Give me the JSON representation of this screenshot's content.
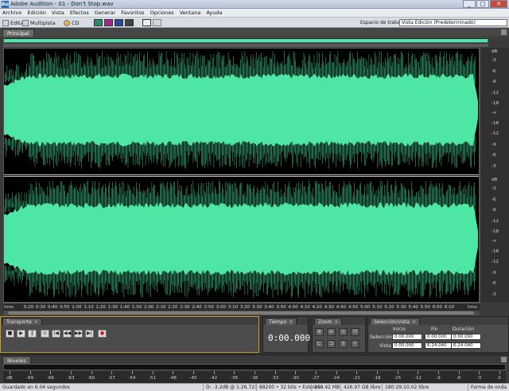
{
  "window": {
    "title": "Adobe Audition - 01 - Don't Stop.wav",
    "buttons": [
      "_",
      "□",
      "✕"
    ]
  },
  "menu": [
    "Archivo",
    "Edición",
    "Vista",
    "Efectos",
    "Generar",
    "Favoritos",
    "Opciones",
    "Ventana",
    "Ayuda"
  ],
  "toolbar": {
    "edit": "Editar",
    "multitrack": "Multipista",
    "cd": "CD",
    "workspace_label": "Espacio de trabajo:",
    "workspace_value": "Vista Edición (Predeterminado)"
  },
  "main_panel": {
    "tab": "Principal",
    "db_labels": [
      "dB",
      "-3",
      "-6",
      "-9",
      "-12",
      "-18",
      "-∞",
      "-18",
      "-12",
      "-9",
      "-6",
      "-3",
      "dB",
      "-3",
      "-6",
      "-9",
      "-12",
      "-18",
      "-∞",
      "-18",
      "-12",
      "-9",
      "-6",
      "-3"
    ],
    "ruler_start": "hms",
    "ruler_end": "hms",
    "ruler_labels": [
      "0:20",
      "0:30",
      "0:40",
      "0:50",
      "1:00",
      "1:10",
      "1:20",
      "1:30",
      "1:40",
      "1:50",
      "2:00",
      "2:10",
      "2:20",
      "2:30",
      "2:40",
      "2:50",
      "3:00",
      "3:10",
      "3:20",
      "3:30",
      "3:40",
      "3:50",
      "4:00",
      "4:10",
      "4:20",
      "4:30",
      "4:40",
      "4:50",
      "5:00",
      "5:10",
      "5:20",
      "5:30",
      "5:40",
      "5:50",
      "6:00",
      "6:10"
    ]
  },
  "transport": {
    "tab": "Transporte",
    "controls": [
      "■",
      "▶",
      "‖",
      "⊙",
      "|◀",
      "◀◀",
      "▶▶",
      "▶|",
      "●"
    ]
  },
  "time_panel": {
    "tab": "Tiempo",
    "value": "0:00.000"
  },
  "zoom_panel": {
    "tab": "Zoom"
  },
  "selection_panel": {
    "tab": "Selección/vista",
    "headers": [
      "Inicio",
      "Fin",
      "Duración"
    ],
    "rows": [
      {
        "label": "Selección",
        "start": "0:00.000",
        "end": "0:00.000",
        "duration": "0:00.000"
      },
      {
        "label": "Vista",
        "start": "0:00.000",
        "end": "6:24.040",
        "duration": "6:24.040"
      }
    ]
  },
  "levels_panel": {
    "tab": "Niveles",
    "labels": [
      "dB",
      "-69",
      "-66",
      "-63",
      "-60",
      "-57",
      "-54",
      "-51",
      "-48",
      "-45",
      "-42",
      "-39",
      "-36",
      "-33",
      "-30",
      "-27",
      "-24",
      "-21",
      "-18",
      "-15",
      "-12",
      "-9",
      "-6",
      "-3",
      "0"
    ]
  },
  "status": {
    "message": "Guardado en 6.04 segundos",
    "level": "D: -3.2dB @",
    "time": "1:26.723",
    "format": "88200 • 32 bits • Estéreo",
    "size": "258.42 MB",
    "free": "426.97 GB libre",
    "free_time": "180:29:10.02 libre",
    "view": "Forma de onda"
  },
  "colors": {
    "waveform": "#4ee6a4",
    "background": "#000000",
    "transport_border": "#c89a2a"
  }
}
